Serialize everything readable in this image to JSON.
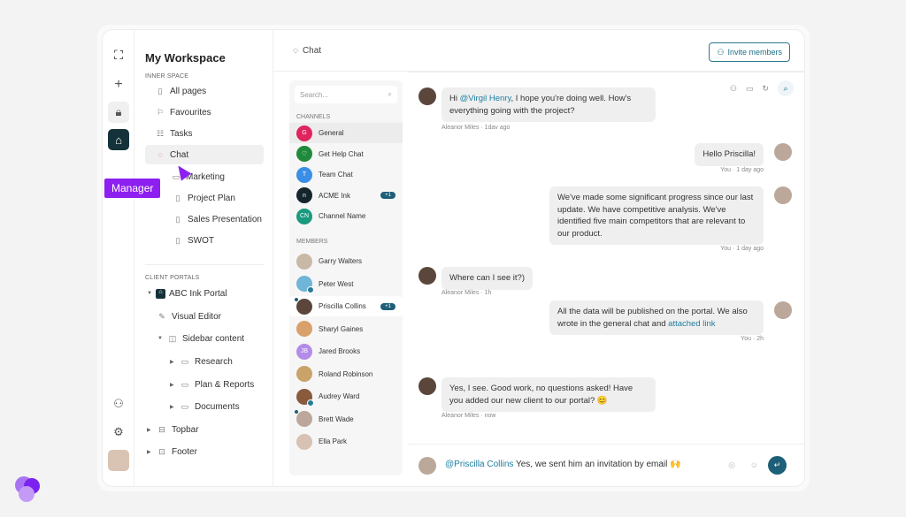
{
  "rail": {
    "icons": [
      "scan-logo-icon",
      "plus-icon",
      "lock-icon",
      "brand-icon",
      "users-icon",
      "settings-icon",
      "user-avatar"
    ]
  },
  "sidebar": {
    "workspace": "My Workspace",
    "inner_space_label": "INNER SPACE",
    "items": [
      {
        "label": "All pages",
        "icon": "page-icon"
      },
      {
        "label": "Favourites",
        "icon": "bookmark-icon"
      },
      {
        "label": "Tasks",
        "icon": "tasks-icon"
      },
      {
        "label": "Chat",
        "icon": "chat-icon"
      },
      {
        "label": "Marketing",
        "icon": "folder-icon"
      },
      {
        "label": "Project Plan",
        "icon": "page-icon"
      },
      {
        "label": "Sales Presentation",
        "icon": "page-icon"
      },
      {
        "label": "SWOT",
        "icon": "page-icon"
      }
    ],
    "client_portals_label": "CLIENT PORTALS",
    "portals": [
      {
        "label": "ABC Ink Portal"
      },
      {
        "label": "Visual Editor"
      },
      {
        "label": "Sidebar content"
      },
      {
        "label": "Research"
      },
      {
        "label": "Plan & Reports"
      },
      {
        "label": "Documents"
      },
      {
        "label": "Topbar"
      },
      {
        "label": "Footer"
      }
    ]
  },
  "tooltip": "Manager",
  "header": {
    "title": "Chat",
    "invite": "Invite members"
  },
  "chatlist": {
    "search_placeholder": "Search...",
    "channels_label": "CHANNELS",
    "channels": [
      {
        "name": "General",
        "initial": "G",
        "color": "#e0245e"
      },
      {
        "name": "Get Help Chat",
        "initial": "♡",
        "color": "#1f8a3c"
      },
      {
        "name": "Team Chat",
        "initial": "T",
        "color": "#3a8ee6"
      },
      {
        "name": "ACME Ink",
        "initial": "n",
        "color": "#14252c",
        "badge": "+1"
      },
      {
        "name": "Channel Name",
        "initial": "CN",
        "color": "#1a9a7e"
      }
    ],
    "members_label": "MEMBERS",
    "members": [
      {
        "name": "Garry Walters",
        "color": "#c9b8a5"
      },
      {
        "name": "Peter West",
        "color": "#6fb5d8"
      },
      {
        "name": "Priscilla Collins",
        "color": "#5a463b",
        "badge": "+1"
      },
      {
        "name": "Sharyl Gaines",
        "color": "#d9a06b"
      },
      {
        "name": "Jared Brooks",
        "color": "#b38ce8",
        "initial": "JB"
      },
      {
        "name": "Roland Robinson",
        "color": "#c9a36a"
      },
      {
        "name": "Audrey Ward",
        "color": "#8a5a3d"
      },
      {
        "name": "Brett Wade",
        "color": "#bba89a"
      },
      {
        "name": "Ella Park",
        "color": "#d8c2b4"
      }
    ]
  },
  "messages": [
    {
      "mention": "@Virgil Henry",
      "text": ", I hope you're doing well. How's everything going with the project?",
      "prefix": "Hi ",
      "meta": "Aleanor Miles · 1dav ago"
    },
    {
      "text": "Hello Priscilla!",
      "meta": "You · 1 day ago"
    },
    {
      "text": "We've made some significant progress since our last update. We have competitive analysis. We've identified five main competitors that are relevant to our product.",
      "meta": "You · 1 day ago"
    },
    {
      "text": "Where can I see it?)",
      "meta": "Aleanor Miles · 1h"
    },
    {
      "text": "All the data will be published on the portal. We also wrote in the general chat and ",
      "link": "attached link",
      "meta": "You · 2h"
    },
    {
      "text": "Yes, I see. Good work, no questions asked! Have you added our new client to our portal? 😊",
      "meta": "Aleanor Miles · now"
    }
  ],
  "composer": {
    "mention": "@Priscilla Collins",
    "text": " Yes, we sent him an invitation by email 🙌"
  }
}
